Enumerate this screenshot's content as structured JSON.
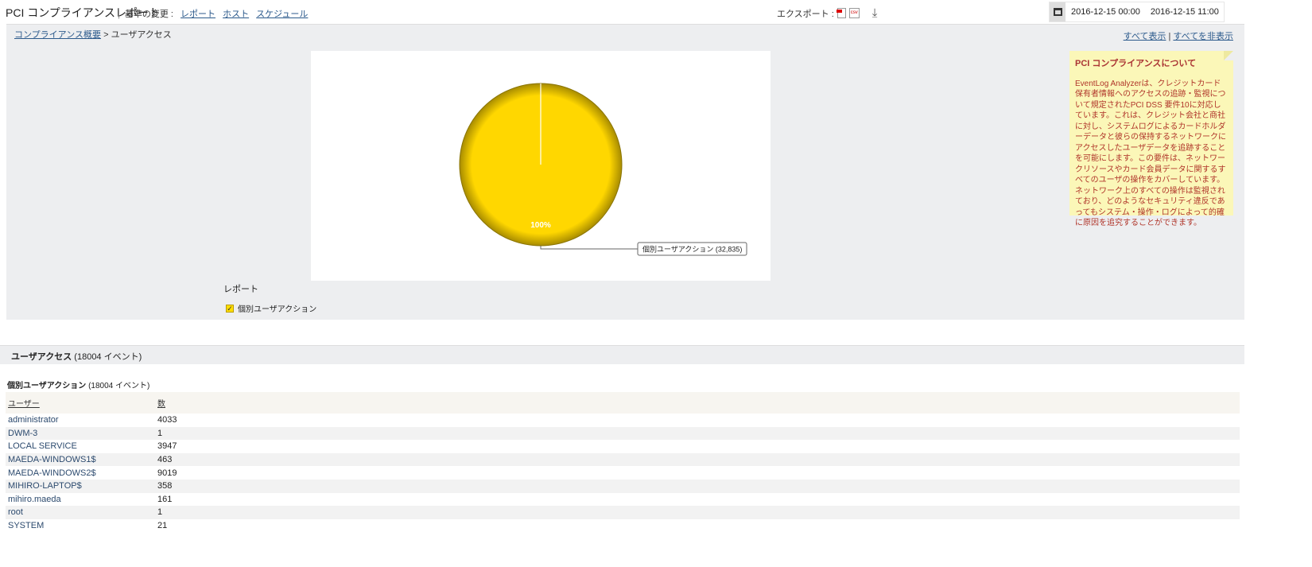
{
  "header": {
    "title": "PCI コンプライアンスレポート",
    "criteria_label": "基準の変更 :",
    "links": [
      "レポート",
      "ホスト",
      "スケジュール"
    ],
    "export_label": "エクスポート :",
    "date_from": "2016-12-15 00:00",
    "date_to": "2016-12-15 11:00"
  },
  "breadcrumb": {
    "parent": "コンプライアンス概要",
    "sep": ">",
    "current": "ユーザアクセス"
  },
  "show_all": "すべて表示",
  "sep": "|",
  "hide_all": "すべてを非表示",
  "note": {
    "title": "PCI コンプライアンスについて",
    "body": "EventLog Analyzerは、クレジットカード保有者情報へのアクセスの追跡・監視について規定されたPCI DSS 要件10に対応しています。これは、クレジット会社と商社に対し、システムログによるカードホルダーデータと彼らの保持するネットワークにアクセスしたユーザデータを追跡することを可能にします。この要件は、ネットワークリソースやカード会員データに関するすべてのユーザの操作をカバーしています。ネットワーク上のすべての操作は監視されており、どのようなセキュリティ違反であってもシステム・操作・ログによって的確に原因を追究することができます。"
  },
  "chart_data": {
    "type": "pie",
    "slices": [
      {
        "label": "個別ユーザアクション",
        "value": 32835,
        "percent": "100%",
        "color": "#FFD700"
      }
    ],
    "callout": "個別ユーザアクション (32,835)"
  },
  "legend": {
    "title": "レポート",
    "items": [
      "個別ユーザアクション"
    ]
  },
  "section": {
    "title": "ユーザアクセス",
    "count": "(18004 イベント)"
  },
  "subsection": {
    "title": "個別ユーザアクション",
    "count": "(18004 イベント)"
  },
  "table": {
    "headers": [
      "ユーザー",
      "数"
    ],
    "rows": [
      [
        "administrator",
        "4033"
      ],
      [
        "DWM-3",
        "1"
      ],
      [
        "LOCAL SERVICE",
        "3947"
      ],
      [
        "MAEDA-WINDOWS1$",
        "463"
      ],
      [
        "MAEDA-WINDOWS2$",
        "9019"
      ],
      [
        "MIHIRO-LAPTOP$",
        "358"
      ],
      [
        "mihiro.maeda",
        "161"
      ],
      [
        "root",
        "1"
      ],
      [
        "SYSTEM",
        "21"
      ]
    ]
  }
}
